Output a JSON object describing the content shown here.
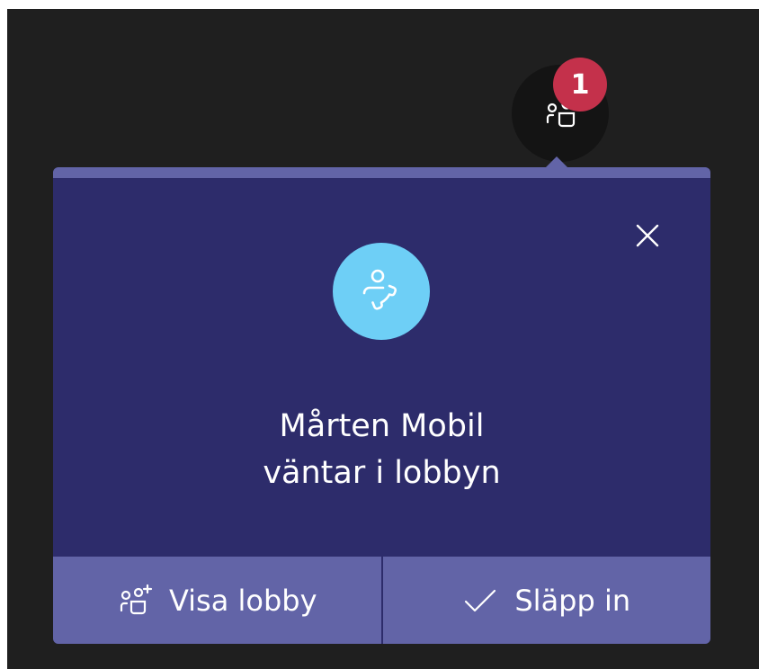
{
  "toolbar": {
    "participants_icon": "participants-icon",
    "badge_count": "1"
  },
  "lobby_popup": {
    "avatar_icon": "phone-person-icon",
    "name": "Mårten Mobil",
    "status": "väntar i lobbyn",
    "close_icon": "close-icon",
    "view_lobby_icon": "add-participants-icon",
    "view_lobby_label": "Visa lobby",
    "admit_icon": "checkmark-icon",
    "admit_label": "Släpp in"
  },
  "colors": {
    "background": "#1f1f1f",
    "popup": "#2d2c6b",
    "accent": "#6264a7",
    "badge": "#c4314b",
    "avatar": "#6ecff6"
  }
}
